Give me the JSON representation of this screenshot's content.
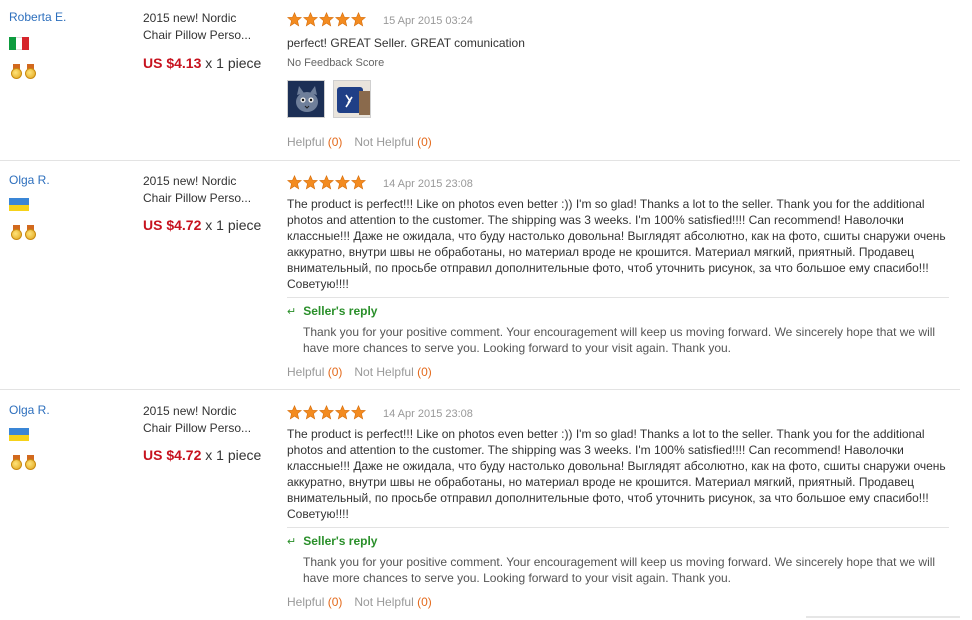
{
  "reviews": [
    {
      "buyer": "Roberta E.",
      "country": "Italy",
      "product_title": "2015 new! Nordic Chair Pillow Perso...",
      "price": "US $4.13",
      "quantity": "x 1 piece",
      "rating": 5,
      "date": "15 Apr 2015 03:24",
      "comment": "perfect! GREAT Seller. GREAT comunication",
      "feedback_note": "No Feedback Score",
      "helpful_label": "Helpful",
      "helpful_count": "(0)",
      "not_helpful_label": "Not Helpful",
      "not_helpful_count": "(0)"
    },
    {
      "buyer": "Olga R.",
      "country": "Ukraine",
      "product_title": "2015 new! Nordic Chair Pillow Perso...",
      "price": "US $4.72",
      "quantity": "x 1 piece",
      "rating": 5,
      "date": "14 Apr 2015 23:08",
      "comment": "The product is perfect!!! Like on photos even better :)) I'm so glad! Thanks a lot to the seller. Thank you for the additional photos and attention to the customer. The shipping was 3 weeks. I'm 100% satisfied!!!! Can recommend! Наволочки классные!!! Даже не ожидала, что буду настолько довольна! Выглядят абсолютно, как на фото, сшиты снаружи очень аккуратно, внутри швы не обработаны, но материал вроде не крошится. Материал мягкий, приятный. Продавец внимательный, по просьбе отправил дополнительные фото, чтоб уточнить рисунок, за что большое ему спасибо!!! Советую!!!!",
      "reply_title": "Seller's reply",
      "reply_text": "Thank you for your positive comment. Your encouragement will keep us moving forward. We sincerely hope that we will have more chances to serve you. Looking forward to your visit again. Thank you.",
      "helpful_label": "Helpful",
      "helpful_count": "(0)",
      "not_helpful_label": "Not Helpful",
      "not_helpful_count": "(0)"
    },
    {
      "buyer": "Olga R.",
      "country": "Ukraine",
      "product_title": "2015 new! Nordic Chair Pillow Perso...",
      "price": "US $4.72",
      "quantity": "x 1 piece",
      "rating": 5,
      "date": "14 Apr 2015 23:08",
      "comment": "The product is perfect!!! Like on photos even better :)) I'm so glad! Thanks a lot to the seller. Thank you for the additional photos and attention to the customer. The shipping was 3 weeks. I'm 100% satisfied!!!! Can recommend! Наволочки классные!!! Даже не ожидала, что буду настолько довольна! Выглядят абсолютно, как на фото, сшиты снаружи очень аккуратно, внутри швы не обработаны, но материал вроде не крошится. Материал мягкий, приятный. Продавец внимательный, по просьбе отправил дополнительные фото, чтоб уточнить рисунок, за что большое ему спасибо!!! Советую!!!!",
      "reply_title": "Seller's reply",
      "reply_text": "Thank you for your positive comment. Your encouragement will keep us moving forward. We sincerely hope that we will have more chances to serve you. Looking forward to your visit again. Thank you.",
      "helpful_label": "Helpful",
      "helpful_count": "(0)",
      "not_helpful_label": "Not Helpful",
      "not_helpful_count": "(0)"
    }
  ],
  "colors": {
    "link": "#2d6fbd",
    "price": "#c7131f",
    "star": "#f38b20",
    "reply": "#2a8f2a",
    "count": "#e46a1c"
  },
  "icons": {
    "star": "star-icon",
    "medal": "medal-icon",
    "reply_arrow": "reply-arrow-icon"
  }
}
